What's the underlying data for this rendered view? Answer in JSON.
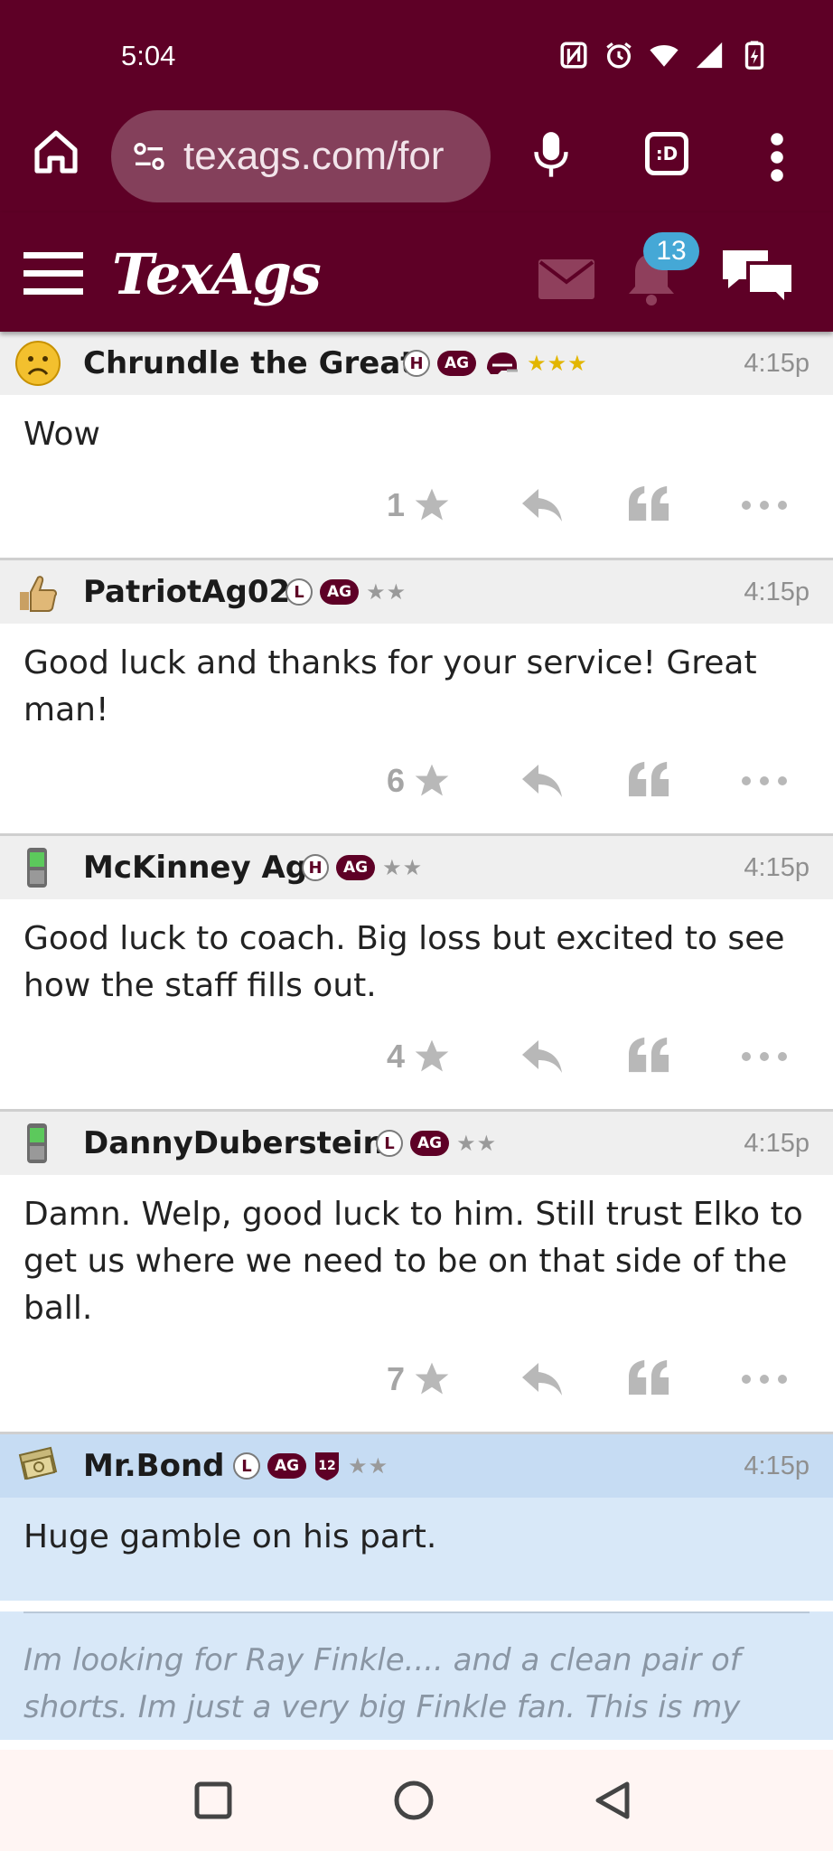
{
  "status": {
    "time": "5:04"
  },
  "browser": {
    "url": "texags.com/for",
    "tab_label": ":D"
  },
  "site": {
    "logo": "TexAgs",
    "notification_count": "13"
  },
  "posts": [
    {
      "user": "Chrundle the Great",
      "badge1": "H",
      "badge_ag": "AG",
      "stars": "★★★",
      "time": "4:15p",
      "body": "Wow",
      "stars_count": "1"
    },
    {
      "user": "PatriotAg02",
      "badge1": "L",
      "badge_ag": "AG",
      "stars": "★★",
      "time": "4:15p",
      "body": "Good luck and thanks for your service! Great man!",
      "stars_count": "6"
    },
    {
      "user": "McKinney Ag",
      "badge1": "H",
      "badge_ag": "AG",
      "stars": "★★",
      "time": "4:15p",
      "body": "Good luck to coach. Big loss but excited to see how the staff fills out.",
      "stars_count": "4"
    },
    {
      "user": "DannyDuberstein",
      "badge1": "L",
      "badge_ag": "AG",
      "stars": "★★",
      "time": "4:15p",
      "body": "Damn. Welp, good luck to him. Still trust Elko to get us where we need to be on that side of the ball.",
      "stars_count": "7"
    },
    {
      "user": "Mr.Bond",
      "badge1": "L",
      "badge_ag": "AG",
      "badge_shield": "12",
      "stars": "★★",
      "time": "4:15p",
      "body": "Huge gamble on his part.",
      "signature": "Im looking for Ray Finkle.... and a clean pair of shorts. Im just a very big Finkle fan. This is my"
    }
  ],
  "colors": {
    "maroon": "#5e0026",
    "badge_blue": "#45a8d6",
    "highlight": "#d8e8f8"
  }
}
